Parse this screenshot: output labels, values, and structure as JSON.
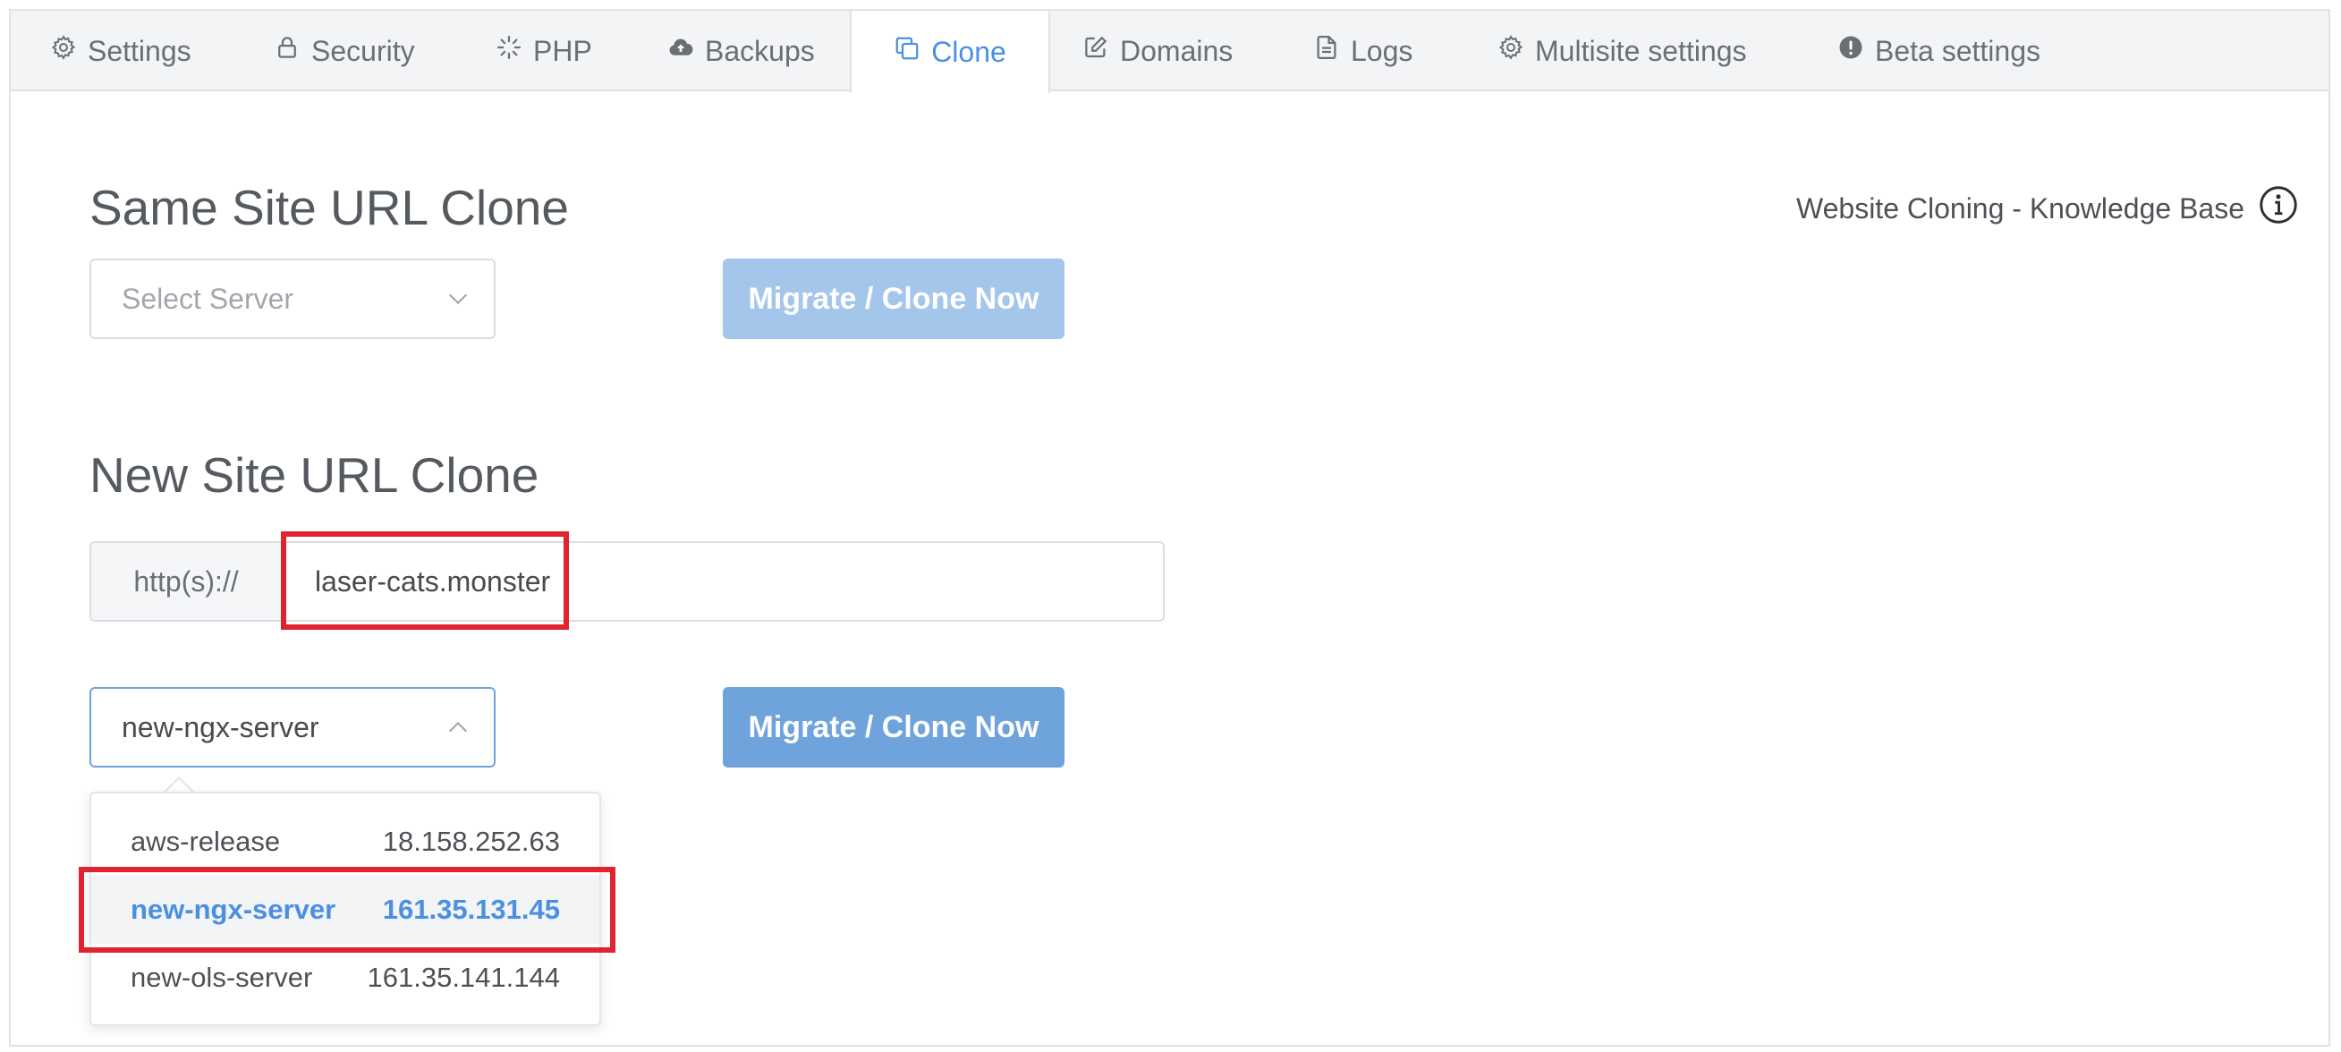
{
  "tabs": [
    {
      "label": "Settings",
      "icon": "gear-icon"
    },
    {
      "label": "Security",
      "icon": "lock-icon"
    },
    {
      "label": "PHP",
      "icon": "spinner-icon"
    },
    {
      "label": "Backups",
      "icon": "cloud-upload-icon"
    },
    {
      "label": "Clone",
      "icon": "copy-icon",
      "active": true
    },
    {
      "label": "Domains",
      "icon": "edit-icon"
    },
    {
      "label": "Logs",
      "icon": "file-icon"
    },
    {
      "label": "Multisite settings",
      "icon": "gear-icon"
    },
    {
      "label": "Beta settings",
      "icon": "exclamation-circle-icon"
    }
  ],
  "same_site": {
    "title": "Same Site URL Clone",
    "select_placeholder": "Select Server",
    "button_label": "Migrate / Clone Now"
  },
  "knowledge_base": {
    "label": "Website Cloning - Knowledge Base",
    "icon": "info-circle-icon"
  },
  "new_site": {
    "title": "New Site URL Clone",
    "url_prefix": "http(s)://",
    "url_value": "laser-cats.monster",
    "selected_server": "new-ngx-server",
    "button_label": "Migrate / Clone Now"
  },
  "server_options": [
    {
      "name": "aws-release",
      "ip": "18.158.252.63"
    },
    {
      "name": "new-ngx-server",
      "ip": "161.35.131.45",
      "selected": true
    },
    {
      "name": "new-ols-server",
      "ip": "161.35.141.144"
    }
  ],
  "colors": {
    "accent": "#4a90e2",
    "button_disabled": "#a4c6ea",
    "button_active": "#6fa3dc",
    "highlight": "#e0232e"
  }
}
